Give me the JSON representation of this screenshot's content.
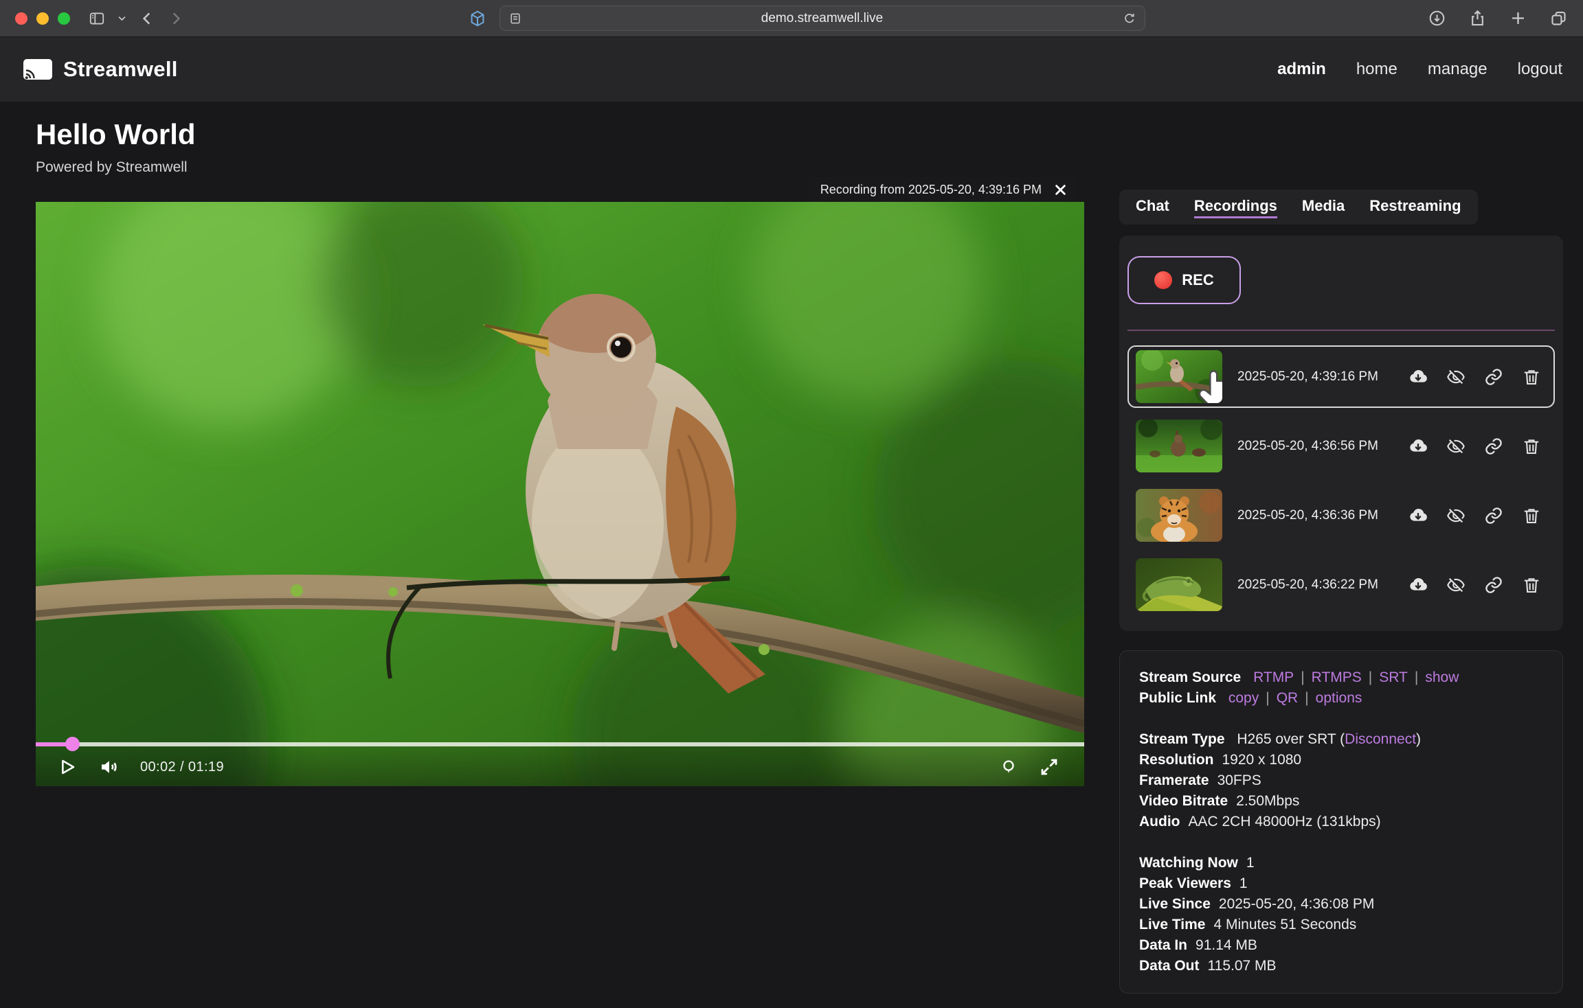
{
  "browser": {
    "url": "demo.streamwell.live"
  },
  "header": {
    "brand": "Streamwell",
    "nav": [
      {
        "label": "admin"
      },
      {
        "label": "home"
      },
      {
        "label": "manage"
      },
      {
        "label": "logout"
      }
    ]
  },
  "page": {
    "title": "Hello World",
    "subtitle": "Powered by Streamwell"
  },
  "player": {
    "banner_text": "Recording from 2025-05-20, 4:39:16 PM",
    "time_display": "00:02 / 01:19",
    "progress_percent": 3.5,
    "icons": [
      "play-icon",
      "volume-icon",
      "pin-icon",
      "fullscreen-icon"
    ]
  },
  "side": {
    "tabs": [
      {
        "label": "Chat",
        "active": false
      },
      {
        "label": "Recordings",
        "active": true
      },
      {
        "label": "Media",
        "active": false
      },
      {
        "label": "Restreaming",
        "active": false
      }
    ],
    "rec_label": "REC",
    "recordings": [
      {
        "timestamp": "2025-05-20, 4:39:16 PM",
        "thumb": "bird-on-branch",
        "selected": true
      },
      {
        "timestamp": "2025-05-20, 4:36:56 PM",
        "thumb": "rabbits-in-grass",
        "selected": false
      },
      {
        "timestamp": "2025-05-20, 4:36:36 PM",
        "thumb": "tiger",
        "selected": false
      },
      {
        "timestamp": "2025-05-20, 4:36:22 PM",
        "thumb": "chameleon",
        "selected": false
      }
    ],
    "row_action_icons": [
      "cloud-download-icon",
      "eye-off-icon",
      "link-icon",
      "trash-icon"
    ]
  },
  "stream_info": {
    "separator": "|",
    "source_label": "Stream Source",
    "source_links": [
      "RTMP",
      "RTMPS",
      "SRT",
      "show"
    ],
    "public_link_label": "Public Link",
    "public_links": [
      "copy",
      "QR",
      "options"
    ],
    "stream_type": {
      "label": "Stream Type",
      "value": "H265 over SRT",
      "open": "(",
      "link": "Disconnect",
      "close": ")"
    },
    "details": [
      {
        "label": "Resolution",
        "value": "1920 x 1080"
      },
      {
        "label": "Framerate",
        "value": "30FPS"
      },
      {
        "label": "Video Bitrate",
        "value": "2.50Mbps"
      },
      {
        "label": "Audio",
        "value": "AAC 2CH 48000Hz (131kbps)"
      }
    ],
    "stats": [
      {
        "label": "Watching Now",
        "value": "1"
      },
      {
        "label": "Peak Viewers",
        "value": "1"
      },
      {
        "label": "Live Since",
        "value": "2025-05-20, 4:36:08 PM"
      },
      {
        "label": "Live Time",
        "value": "4 Minutes 51 Seconds"
      },
      {
        "label": "Data In",
        "value": "91.14 MB"
      },
      {
        "label": "Data Out",
        "value": "115.07 MB"
      }
    ]
  },
  "colors": {
    "accent_purple": "#bd7be0",
    "rec_red": "#e0302a",
    "progress_pink": "#ee82e9",
    "selected_row_border": "#d9d9d9",
    "tab_underline": "#b07ad1",
    "divider_purple": "#6b4968"
  }
}
